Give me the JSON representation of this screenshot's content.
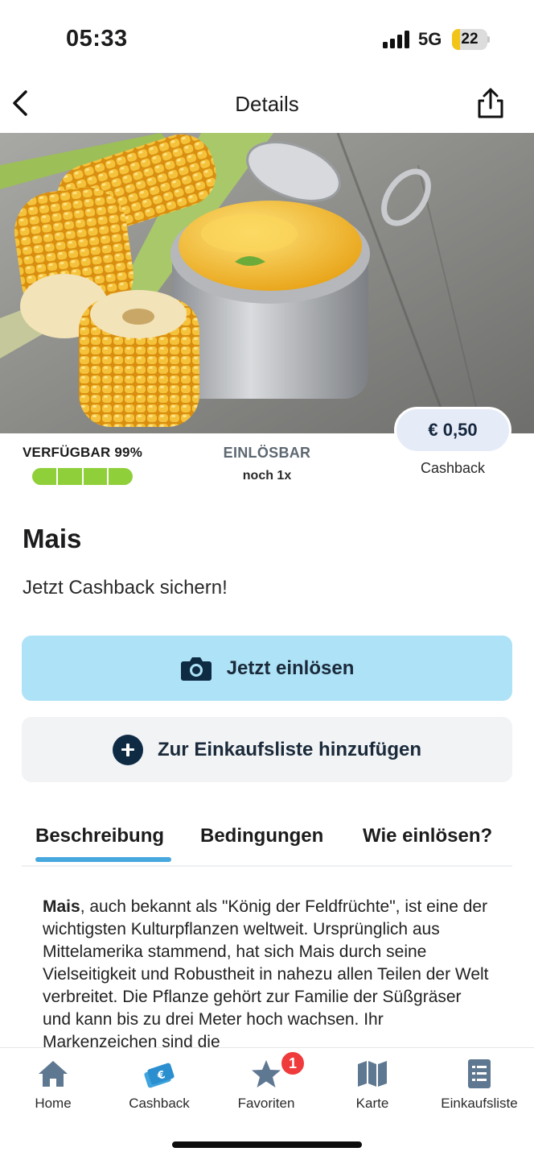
{
  "status_bar": {
    "time": "05:33",
    "network": "5G",
    "battery": "22",
    "battery_level": 0.22
  },
  "header": {
    "title": "Details",
    "back_icon": "chevron-left-icon",
    "share_icon": "share-icon"
  },
  "hero": {
    "description": "Corn cobs and a can of sweet corn"
  },
  "availability": {
    "label": "VERFÜGBAR 99%",
    "level": 0.99,
    "segments": 4
  },
  "redeemable": {
    "label": "EINLÖSBAR",
    "count": "noch 1x"
  },
  "cashback": {
    "amount": "€ 0,50",
    "label": "Cashback"
  },
  "product": {
    "title": "Mais",
    "subtitle": "Jetzt Cashback sichern!"
  },
  "buttons": {
    "redeem": {
      "label": "Jetzt einlösen",
      "icon": "camera-icon",
      "color": "#aee2f6"
    },
    "add_to_list": {
      "label": "Zur Einkaufsliste hinzufügen",
      "icon": "plus-circle-icon"
    }
  },
  "tabs": [
    {
      "label": "Beschreibung",
      "active": true
    },
    {
      "label": "Bedingungen",
      "active": false
    },
    {
      "label": "Wie einlösen?",
      "active": false
    }
  ],
  "description": {
    "lead": "Mais",
    "text": ", auch bekannt als \"König der Feldfrüchte\", ist eine der wichtigsten Kulturpflanzen weltweit. Ursprünglich aus Mittelamerika stammend, hat sich Mais durch seine Vielseitigkeit und Robustheit in nahezu allen Teilen der Welt verbreitet. Die Pflanze gehört zur Familie der Süßgräser und kann bis zu drei Meter hoch wachsen. Ihr Markenzeichen sind die"
  },
  "tab_bar": {
    "items": [
      {
        "label": "Home",
        "icon": "home-icon"
      },
      {
        "label": "Cashback",
        "icon": "cashback-icon"
      },
      {
        "label": "Favoriten",
        "icon": "star-icon",
        "badge": "1"
      },
      {
        "label": "Karte",
        "icon": "map-icon"
      },
      {
        "label": "Einkaufsliste",
        "icon": "list-icon"
      }
    ]
  },
  "colors": {
    "accent": "#47a8de",
    "availability": "#8fcf3a",
    "badge": "#ef3b3b",
    "icon_dark": "#0f2b44",
    "tab_icon": "#5f7891"
  }
}
